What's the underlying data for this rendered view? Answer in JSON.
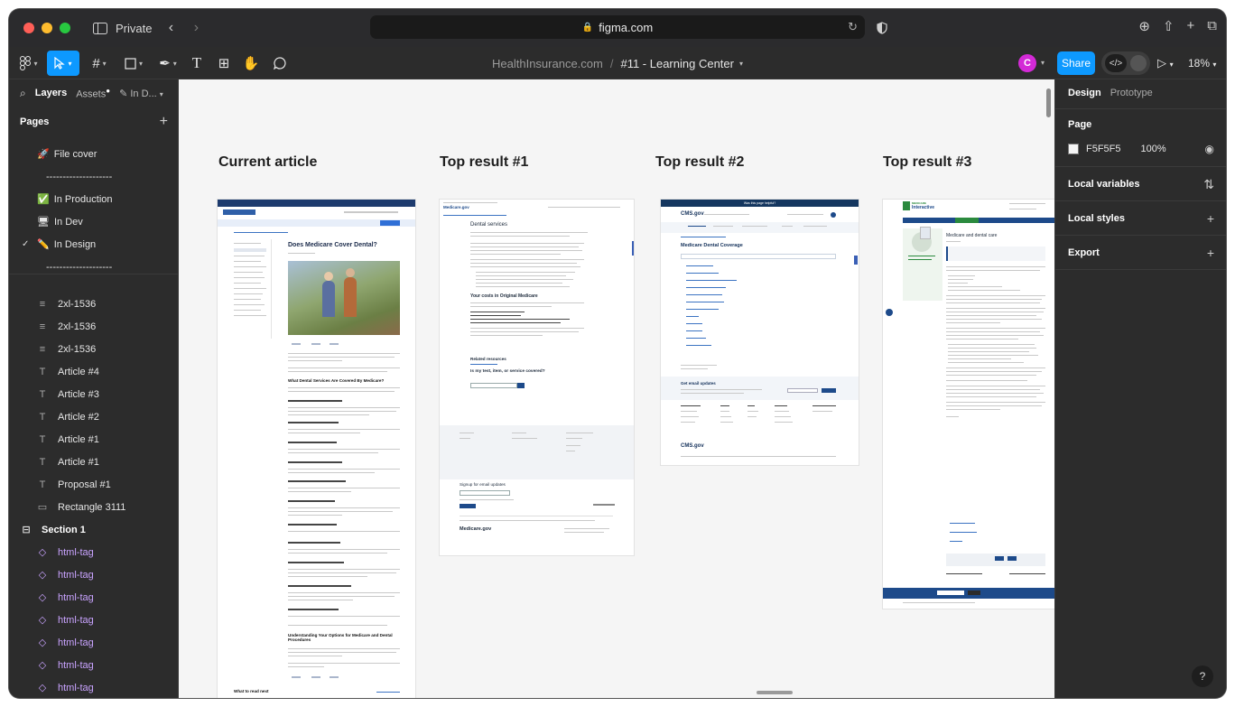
{
  "browser": {
    "private_label": "Private",
    "url": "figma.com"
  },
  "toolbar": {
    "breadcrumb_project": "HealthInsurance.com",
    "breadcrumb_separator": "/",
    "file_name": "#11 - Learning Center",
    "avatar_initial": "C",
    "share_label": "Share",
    "zoom": "18%"
  },
  "left_panel": {
    "tabs": {
      "layers": "Layers",
      "assets": "Assets",
      "inde": "In D..."
    },
    "pages_title": "Pages",
    "pages": [
      {
        "label": "File cover",
        "emoji": "🚀",
        "checked": false
      },
      {
        "label": "--------------------",
        "emoji": "",
        "checked": false
      },
      {
        "label": "In Production",
        "emoji": "✅",
        "checked": false
      },
      {
        "label": "In Dev",
        "emoji": "🖥",
        "checked": false
      },
      {
        "label": "In Design",
        "emoji": "✏️",
        "checked": true
      },
      {
        "label": "--------------------",
        "emoji": "",
        "checked": false
      }
    ],
    "layers": [
      {
        "label": "2xl-1536",
        "type": "text-block"
      },
      {
        "label": "2xl-1536",
        "type": "text-block"
      },
      {
        "label": "2xl-1536",
        "type": "text-block"
      },
      {
        "label": "Article #4",
        "type": "text"
      },
      {
        "label": "Article #3",
        "type": "text"
      },
      {
        "label": "Article #2",
        "type": "text"
      },
      {
        "label": "Article #1",
        "type": "text"
      },
      {
        "label": "Article #1",
        "type": "text"
      },
      {
        "label": "Proposal #1",
        "type": "text"
      },
      {
        "label": "Rectangle 3111",
        "type": "rect"
      },
      {
        "label": "Section 1",
        "type": "section"
      },
      {
        "label": "html-tag",
        "type": "component"
      },
      {
        "label": "html-tag",
        "type": "component"
      },
      {
        "label": "html-tag",
        "type": "component"
      },
      {
        "label": "html-tag",
        "type": "component"
      },
      {
        "label": "html-tag",
        "type": "component"
      },
      {
        "label": "html-tag",
        "type": "component"
      },
      {
        "label": "html-tag",
        "type": "component"
      }
    ]
  },
  "canvas": {
    "background": "#F5F5F5",
    "frames": [
      {
        "label": "Current article"
      },
      {
        "label": "Top result #1"
      },
      {
        "label": "Top result #2"
      },
      {
        "label": "Top result #3"
      }
    ],
    "art1": {
      "title": "Does Medicare Cover Dental?",
      "h2_a": "What Dental Services Are Covered By Medicare?",
      "h2_b": "Understanding Your Options for Medicare and Dental Procedures",
      "footer": "What to read next"
    },
    "art2": {
      "logo": "Medicare.gov",
      "title": "Dental services",
      "costs_title": "Your costs in Original Medicare",
      "related": "Related resources",
      "question": "Is my test, item, or service covered?",
      "signup": "Signup for email updates",
      "footer_logo": "Medicare.gov"
    },
    "art3": {
      "banner": "Was this page helpful?",
      "logo": "CMS.gov",
      "title": "Medicare Dental Coverage",
      "email": "Get email updates",
      "footer_logo": "CMS.gov"
    },
    "art4": {
      "logo_top": "MEDICARE",
      "logo_bottom": "Interactive",
      "title": "Medicare and dental care"
    }
  },
  "right_panel": {
    "tabs": {
      "design": "Design",
      "prototype": "Prototype"
    },
    "page_title": "Page",
    "page_color": "F5F5F5",
    "page_opacity": "100%",
    "local_variables": "Local variables",
    "local_styles": "Local styles",
    "export": "Export"
  },
  "help_label": "?",
  "colors": {
    "accent": "#0d99ff",
    "component": "#c9a3ff",
    "panel": "#2c2c2c"
  }
}
